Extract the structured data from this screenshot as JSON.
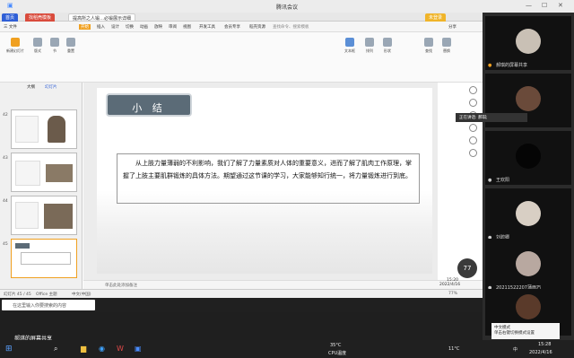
{
  "window": {
    "title": "腾讯会议"
  },
  "wps": {
    "tabs": [
      {
        "label": "首页"
      },
      {
        "label": "找稻壳模板"
      },
      {
        "label": "提高所之人锻…必锻展示详细"
      }
    ],
    "login_label": "未登录",
    "menu": [
      "三 文件",
      "开始",
      "插入",
      "设计",
      "切换",
      "动画",
      "放映",
      "审阅",
      "视图",
      "开发工具",
      "会员专享",
      "稻壳资源",
      "查找命令、搜索模板"
    ],
    "share_label": "分享",
    "ribbon": [
      "新建幻灯片",
      "版式",
      "节",
      "重置",
      "文本框",
      "排列",
      "形状",
      "查找",
      "替换"
    ],
    "slides": [
      {
        "num": "42"
      },
      {
        "num": "43"
      },
      {
        "num": "44"
      },
      {
        "num": "45"
      }
    ],
    "slide_panel_tabs": [
      "大纲",
      "幻灯片"
    ],
    "current_slide": {
      "title": "小 结",
      "body": "从上肢力量薄弱的不利影响，我们了解了力量素质对人体的重要意义，进而了解了肌肉工作原理，掌握了上肢主要肌群锻炼的具体方法。期望通过这节课的学习，大家能够知行统一，将力量锻炼进行到底。"
    },
    "notes_placeholder": "单击此处添加备注",
    "status": {
      "slide_count": "幻灯片 45 / 45",
      "theme": "Office 主题",
      "lang": "中文(中国)",
      "zoom": "77%",
      "time": "15:20",
      "date": "2022/4/16"
    }
  },
  "inner_taskbar": {
    "search_placeholder": "在这里输入你要搜索的内容"
  },
  "meeting": {
    "sharer_label": "郝琪的屏幕共享",
    "speaking_label": "正在讲话: 郝琪;",
    "participants": [
      {
        "name": "郝琪的屏幕共享"
      },
      {
        "name": ""
      },
      {
        "name": "王欢阳"
      },
      {
        "name": "刘碧卿"
      },
      {
        "name": "20211522207蒲雨巧"
      },
      {
        "name": ""
      }
    ],
    "ime_label": "中文模式",
    "ime_hint": "单击右键切换模式设置",
    "badge": "77"
  },
  "taskbar": {
    "weather_temp": "35°C",
    "weather_label": "CPU温度",
    "temp": "11°C",
    "ime": "中",
    "time": "15:28",
    "date": "2022/4/16"
  }
}
